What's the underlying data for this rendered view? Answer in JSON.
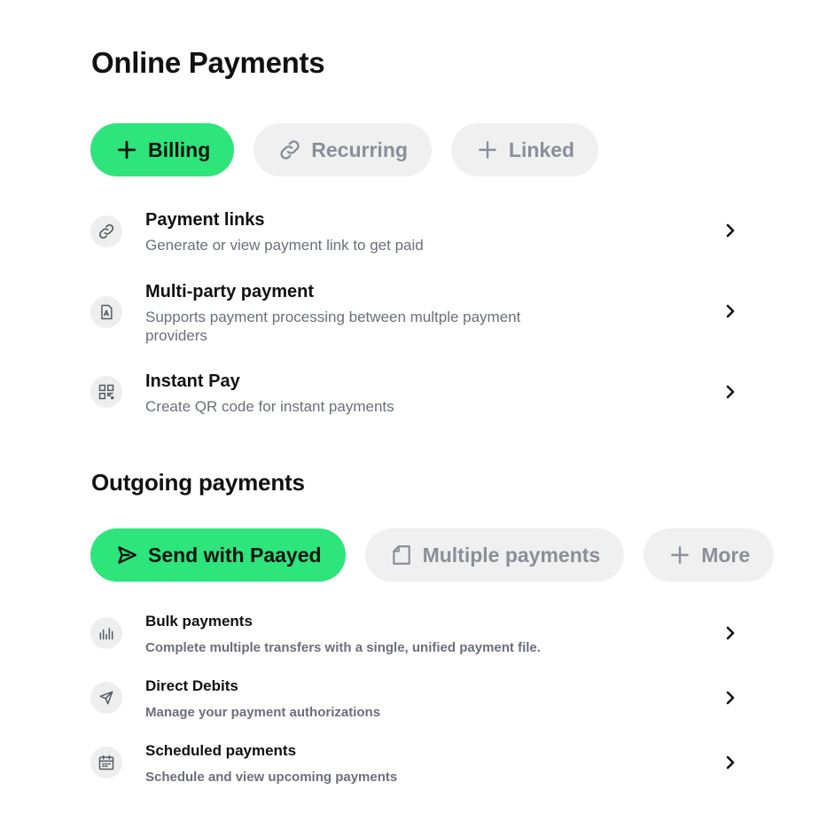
{
  "online": {
    "title": "Online Payments",
    "tabs": [
      {
        "label": "Billing",
        "icon": "plus-icon",
        "active": true
      },
      {
        "label": "Recurring",
        "icon": "link-icon",
        "active": false
      },
      {
        "label": "Linked",
        "icon": "plus-icon",
        "active": false
      }
    ],
    "items": [
      {
        "title": "Payment links",
        "subtitle": "Generate or view payment link to get paid",
        "icon": "link-icon"
      },
      {
        "title": "Multi-party payment",
        "subtitle": "Supports payment processing between multple payment providers",
        "icon": "document-icon"
      },
      {
        "title": "Instant Pay",
        "subtitle": "Create QR code for instant payments",
        "icon": "qr-code-icon"
      }
    ]
  },
  "outgoing": {
    "title": "Outgoing payments",
    "tabs": [
      {
        "label": "Send with Paayed",
        "icon": "send-icon",
        "active": true
      },
      {
        "label": "Multiple payments",
        "icon": "file-icon",
        "active": false
      },
      {
        "label": "More",
        "icon": "plus-icon",
        "active": false
      }
    ],
    "items": [
      {
        "title": "Bulk payments",
        "subtitle": "Complete multiple transfers with a single, unified payment file.",
        "icon": "bar-chart-icon"
      },
      {
        "title": "Direct Debits",
        "subtitle": "Manage your payment authorizations",
        "icon": "send-icon"
      },
      {
        "title": "Scheduled payments",
        "subtitle": "Schedule and view upcoming payments",
        "icon": "calendar-icon"
      }
    ]
  },
  "colors": {
    "accent": "#2ee57c",
    "pill_inactive_bg": "#f0f0f0",
    "muted_text": "#6b7079"
  }
}
